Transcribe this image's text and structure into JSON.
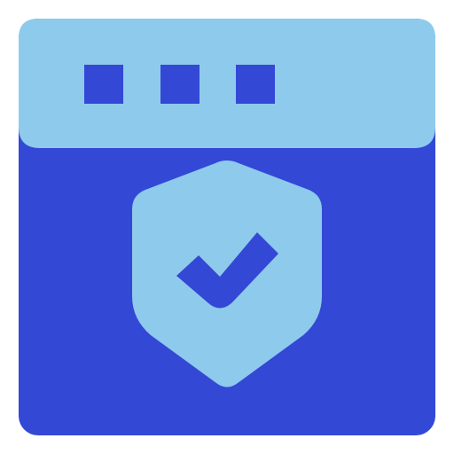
{
  "icon": {
    "name": "secure-browser-window-icon",
    "colors": {
      "window_body": "#3448d6",
      "title_bar": "#8ecaec",
      "window_dots": "#3448d6",
      "shield": "#8ecaec",
      "checkmark": "#3448d6",
      "background": "#ffffff"
    }
  },
  "title_bar": {
    "dots": [
      "window-dot-icon",
      "window-dot-icon",
      "window-dot-icon"
    ]
  },
  "shield": {
    "icon": "shield-icon",
    "badge": "checkmark-icon"
  }
}
